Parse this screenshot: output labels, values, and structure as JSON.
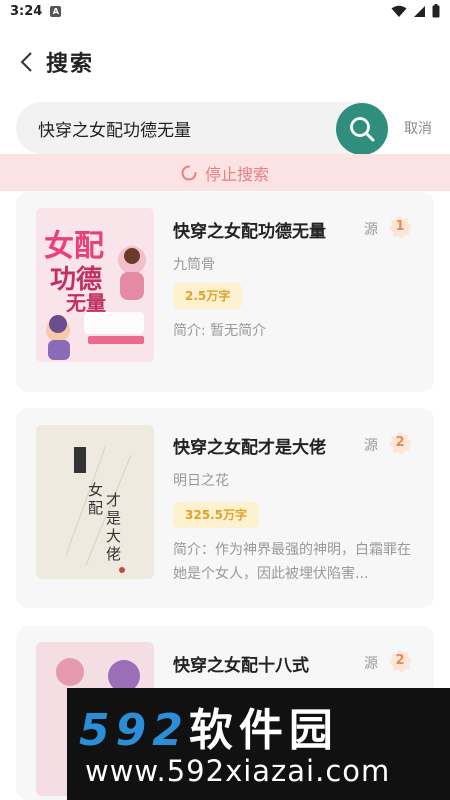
{
  "status_bar": {
    "time": "3:24",
    "badge": "A"
  },
  "header": {
    "title": "搜索"
  },
  "search": {
    "query": "快穿之女配功德无量",
    "cancel_label": "取消"
  },
  "stop_search_label": "停止搜索",
  "results": [
    {
      "title": "快穿之女配功德无量",
      "source_label": "源",
      "rank": "1",
      "author": "九筒骨",
      "word_count": "2.5万字",
      "intro": "简介: 暂无简介",
      "cover": {
        "title_chars": "女配功德无量",
        "bg": "#f9e4ea"
      }
    },
    {
      "title": "快穿之女配才是大佬",
      "source_label": "源",
      "rank": "2",
      "author": "明日之花",
      "word_count": "325.5万字",
      "intro": "简介：作为神界最强的神明，白霜罪在她是个女人，因此被埋伏陷害...",
      "cover": {
        "title_chars": "女配才是大佬",
        "bg": "#efeae0"
      }
    },
    {
      "title": "快穿之女配十八式",
      "source_label": "源",
      "rank": "2",
      "author": "",
      "word_count": "",
      "intro": "",
      "cover": {
        "title_chars": "",
        "bg": "#f4dde3"
      }
    }
  ],
  "watermark": {
    "brand_num": "592",
    "brand_cn": "软件园",
    "url": "www.592xiazai.com"
  },
  "colors": {
    "accent": "#2f8f7c",
    "stop_bar_bg": "#fbe3e4",
    "stop_text": "#e8807f",
    "rank": "#e28b58",
    "tag_bg": "#fdf1cf",
    "tag_text": "#e0a12d"
  }
}
